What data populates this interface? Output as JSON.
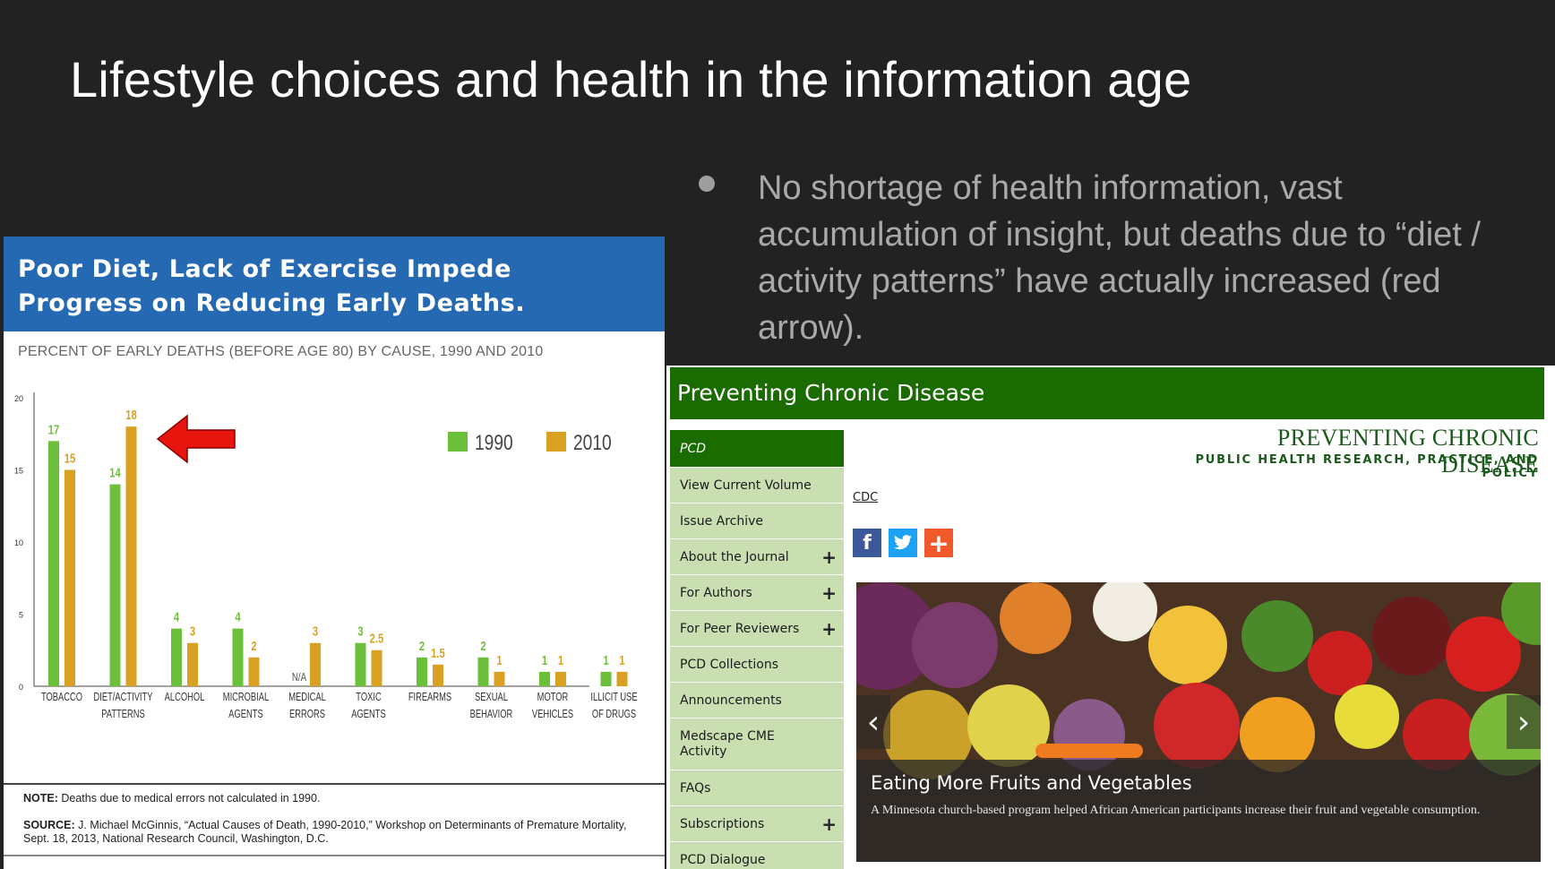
{
  "slide": {
    "title": "Lifestyle choices and health in the information age",
    "bullet": "No shortage of health information, vast accumulation of insight, but deaths due to “diet / activity patterns” have actually increased (red arrow)."
  },
  "infographic": {
    "header": "Poor Diet, Lack of Exercise Impede Progress on Reducing Early Deaths.",
    "subtitle": "PERCENT OF EARLY DEATHS (BEFORE AGE 80) BY CAUSE, 1990 AND 2010",
    "note_label": "NOTE:",
    "note_text": " Deaths due to medical errors not calculated in 1990.",
    "source_label": "SOURCE:",
    "source_text": " J. Michael McGinnis, “Actual Causes of Death, 1990-2010,” Workshop on Determinants of Premature Mortality, Sept. 18, 2013, National Research Council, Washington, D.C.",
    "na_label": "N/A",
    "arrow_color": "#e8150f"
  },
  "chart_data": {
    "type": "bar",
    "categories": [
      [
        "TOBACCO"
      ],
      [
        "DIET/ACTIVITY",
        "PATTERNS"
      ],
      [
        "ALCOHOL"
      ],
      [
        "MICROBIAL",
        "AGENTS"
      ],
      [
        "MEDICAL",
        "ERRORS"
      ],
      [
        "TOXIC",
        "AGENTS"
      ],
      [
        "FIREARMS"
      ],
      [
        "SEXUAL",
        "BEHAVIOR"
      ],
      [
        "MOTOR",
        "VEHICLES"
      ],
      [
        "ILLICIT USE",
        "OF DRUGS"
      ]
    ],
    "series": [
      {
        "name": "1990",
        "color": "#6cbf3b",
        "values": [
          17,
          14,
          4,
          4,
          null,
          3,
          2,
          2,
          1,
          1
        ],
        "labels": [
          "17",
          "14",
          "4",
          "4",
          "",
          "3",
          "2",
          "2",
          "1",
          "1"
        ]
      },
      {
        "name": "2010",
        "color": "#d9a021",
        "values": [
          15,
          18,
          3,
          2,
          3,
          2.5,
          1.5,
          1,
          1,
          1
        ],
        "labels": [
          "15",
          "18",
          "3",
          "2",
          "3",
          "2.5",
          "1.5",
          "1",
          "1",
          "1"
        ]
      }
    ],
    "yticks": [
      "0",
      "5",
      "10",
      "15",
      "20"
    ],
    "ylim": [
      0,
      20
    ],
    "legend": "top-right"
  },
  "pcd": {
    "topbar": "Preventing Chronic Disease",
    "logo_main": "PREVENTING CHRONIC DISEASE",
    "logo_sub": "PUBLIC HEALTH RESEARCH, PRACTICE, AND POLICY",
    "cdc_link": "CDC",
    "share": {
      "facebook": "f",
      "twitter": "t",
      "plus": "+"
    },
    "nav": [
      {
        "label": "PCD",
        "active": true,
        "plus": false
      },
      {
        "label": "View Current Volume",
        "plus": false
      },
      {
        "label": "Issue Archive",
        "plus": false
      },
      {
        "label": "About the Journal",
        "plus": true
      },
      {
        "label": "For Authors",
        "plus": true
      },
      {
        "label": "For Peer Reviewers",
        "plus": true
      },
      {
        "label": "PCD Collections",
        "plus": false
      },
      {
        "label": "Announcements",
        "plus": false
      },
      {
        "label": "Medscape CME Activity",
        "plus": false,
        "tall": true
      },
      {
        "label": "FAQs",
        "plus": false
      },
      {
        "label": "Subscriptions",
        "plus": true
      },
      {
        "label": "PCD Dialogue",
        "plus": false
      }
    ],
    "carousel": {
      "title": "Eating More Fruits and Vegetables",
      "body": "A Minnesota church-based program helped African American participants increase their fruit and vegetable consumption.",
      "prev": "‹",
      "next": "›"
    }
  }
}
